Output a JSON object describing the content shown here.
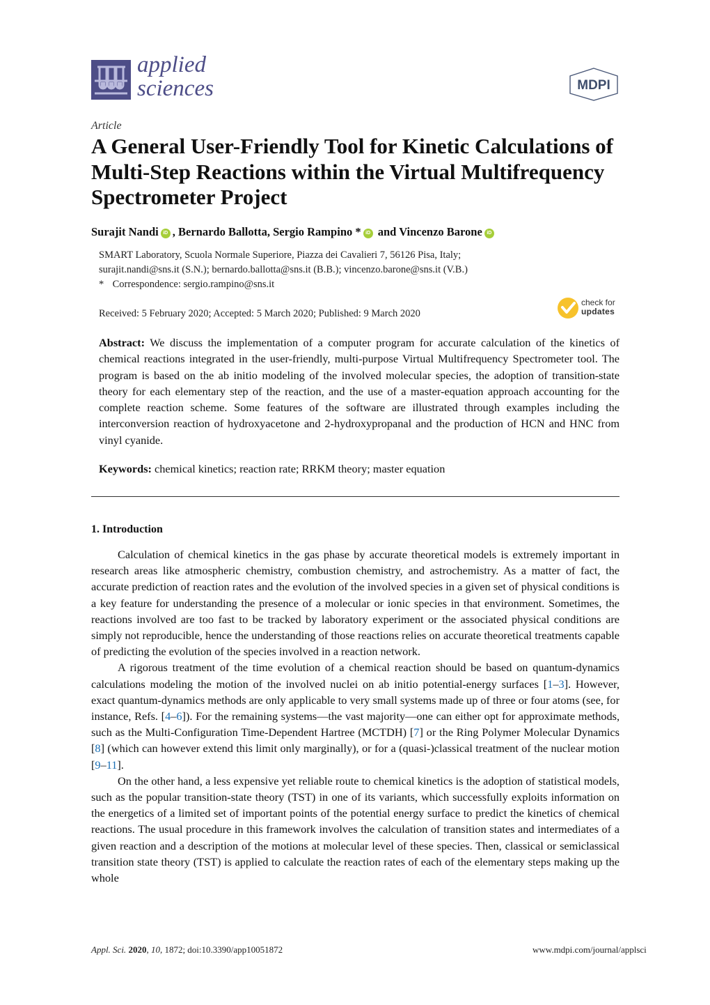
{
  "header": {
    "journal_name_line1": "applied",
    "journal_name_line2": "sciences",
    "publisher": "MDPI",
    "brand_color": "#4d4d87"
  },
  "article": {
    "type": "Article",
    "title": "A General User-Friendly Tool for Kinetic Calculations of Multi-Step Reactions within the Virtual Multifrequency Spectrometer Project",
    "authors": [
      {
        "name": "Surajit Nandi",
        "orcid": true,
        "corresponding": false,
        "sep": ", "
      },
      {
        "name": "Bernardo Ballotta",
        "orcid": false,
        "corresponding": false,
        "sep": ", "
      },
      {
        "name": "Sergio Rampino",
        "orcid": true,
        "corresponding": true,
        "sep": " and "
      },
      {
        "name": "Vincenzo Barone",
        "orcid": true,
        "corresponding": false,
        "sep": ""
      }
    ],
    "orcid_label": "iD",
    "corresponding_mark": "*",
    "affiliation": "SMART Laboratory, Scuola Normale Superiore, Piazza dei Cavalieri 7, 56126 Pisa, Italy;",
    "emails": "surajit.nandi@sns.it (S.N.); bernardo.ballotta@sns.it (B.B.); vincenzo.barone@sns.it (V.B.)",
    "correspondence": "Correspondence: sergio.rampino@sns.it",
    "dates": "Received: 5 February 2020; Accepted: 5 March 2020; Published: 9 March 2020",
    "check_updates_line1": "check for",
    "check_updates_line2": "updates",
    "abstract_label": "Abstract:",
    "abstract": "We discuss the implementation of a computer program for accurate calculation of the kinetics of chemical reactions integrated in the user-friendly, multi-purpose Virtual Multifrequency Spectrometer tool. The program is based on the ab initio modeling of the involved molecular species, the adoption of transition-state theory for each elementary step of the reaction, and the use of a master-equation approach accounting for the complete reaction scheme. Some features of the software are illustrated through examples including the interconversion reaction of hydroxyacetone and 2-hydroxypropanal and the production of HCN and HNC from vinyl cyanide.",
    "keywords_label": "Keywords:",
    "keywords": "chemical kinetics; reaction rate; RRKM theory; master equation"
  },
  "section": {
    "heading": "1. Introduction",
    "paragraphs": [
      [
        {
          "t": "Calculation of chemical kinetics in the gas phase by accurate theoretical models is extremely important in research areas like atmospheric chemistry, combustion chemistry, and astrochemistry. As a matter of fact, the accurate prediction of reaction rates and the evolution of the involved species in a given set of physical conditions is a key feature for understanding the presence of a molecular or ionic species in that environment. Sometimes, the reactions involved are too fast to be tracked by laboratory experiment or the associated physical conditions are simply not reproducible, hence the understanding of those reactions relies on accurate theoretical treatments capable of predicting the evolution of the species involved in a reaction network."
        }
      ],
      [
        {
          "t": "A rigorous treatment of the time evolution of a chemical reaction should be based on quantum-dynamics calculations modeling the motion of the involved nuclei on ab initio potential-energy surfaces ["
        },
        {
          "r": "1"
        },
        {
          "t": "–"
        },
        {
          "r": "3"
        },
        {
          "t": "]. However, exact quantum-dynamics methods are only applicable to very small systems made up of three or four atoms (see, for instance, Refs. ["
        },
        {
          "r": "4"
        },
        {
          "t": "–"
        },
        {
          "r": "6"
        },
        {
          "t": "]). For the remaining systems—the vast majority—one can either opt for approximate methods, such as the Multi-Configuration Time-Dependent Hartree (MCTDH) ["
        },
        {
          "r": "7"
        },
        {
          "t": "] or the Ring Polymer Molecular Dynamics ["
        },
        {
          "r": "8"
        },
        {
          "t": "] (which can however extend this limit only marginally), or for a (quasi-)classical treatment of the nuclear motion ["
        },
        {
          "r": "9"
        },
        {
          "t": "–"
        },
        {
          "r": "11"
        },
        {
          "t": "]."
        }
      ],
      [
        {
          "t": "On the other hand, a less expensive yet reliable route to chemical kinetics is the adoption of statistical models, such as the popular transition-state theory (TST) in one of its variants, which successfully exploits information on the energetics of a limited set of important points of the potential energy surface to predict the kinetics of chemical reactions. The usual procedure in this framework involves the calculation of transition states and intermediates of a given reaction and a description of the motions at molecular level of these species. Then, classical or semiclassical transition state theory (TST) is applied to calculate the reaction rates of each of the elementary steps making up the whole"
        }
      ]
    ]
  },
  "footer": {
    "journal_abbrev": "Appl. Sci.",
    "year": "2020",
    "volume": "10",
    "rest": ", 1872; doi:10.3390/app10051872",
    "url": "www.mdpi.com/journal/applsci"
  },
  "colors": {
    "orcid": "#a6ce39",
    "link": "#1a6fb5",
    "updates": "#f7c22b"
  }
}
